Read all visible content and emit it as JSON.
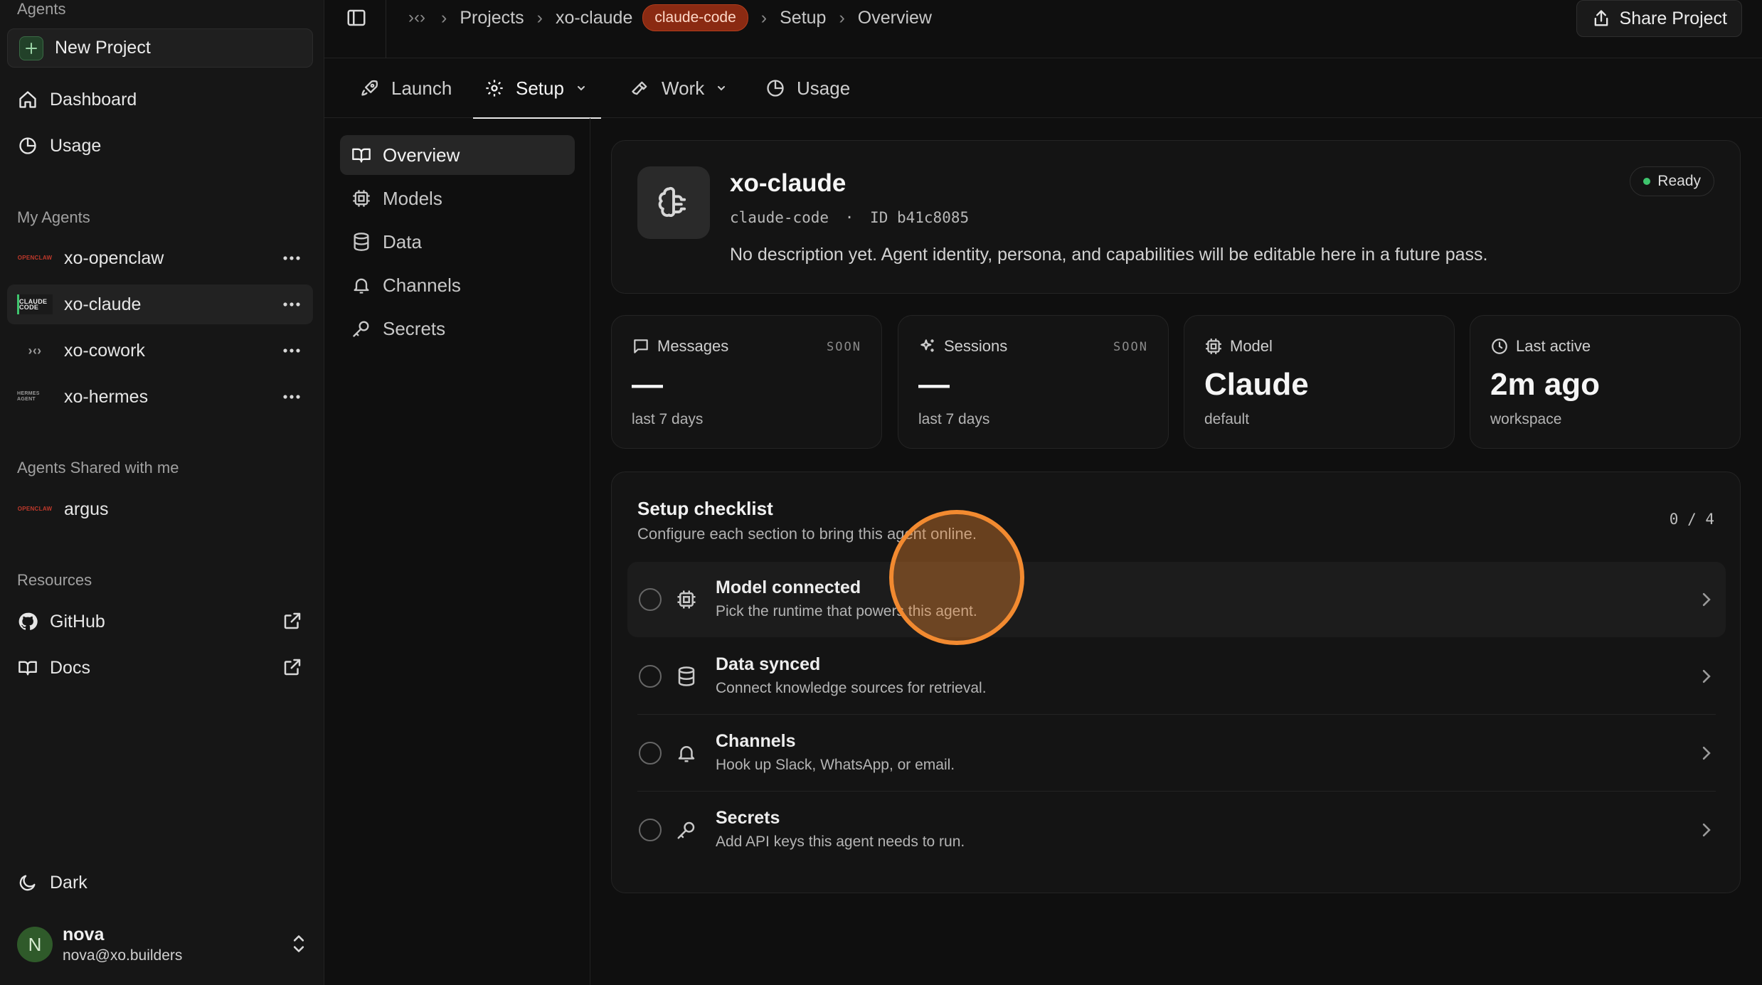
{
  "sidebar": {
    "agents_label": "Agents",
    "new_project": "New Project",
    "nav": [
      {
        "label": "Dashboard",
        "icon": "home-icon"
      },
      {
        "label": "Usage",
        "icon": "pie-chart-icon"
      }
    ],
    "my_agents_label": "My Agents",
    "my_agents": [
      {
        "name": "xo-openclaw",
        "logo": "OPENCLAW"
      },
      {
        "name": "xo-claude",
        "logo": "CLAUDE CODE",
        "active": true
      },
      {
        "name": "xo-cowork",
        "logo": "›‹›"
      },
      {
        "name": "xo-hermes",
        "logo": "HERMES AGENT"
      }
    ],
    "shared_label": "Agents Shared with me",
    "shared": [
      {
        "name": "argus",
        "logo": "OPENCLAW"
      }
    ],
    "resources_label": "Resources",
    "resources": [
      {
        "label": "GitHub"
      },
      {
        "label": "Docs"
      }
    ],
    "theme_label": "Dark",
    "user": {
      "initial": "N",
      "name": "nova",
      "email": "nova@xo.builders"
    }
  },
  "topbar": {
    "logo": "›‹›",
    "breadcrumb": [
      "Projects",
      "xo-claude",
      "Setup",
      "Overview"
    ],
    "pill": "claude-code",
    "share_label": "Share Project"
  },
  "tabs": [
    {
      "label": "Launch"
    },
    {
      "label": "Setup",
      "active": true
    },
    {
      "label": "Work"
    },
    {
      "label": "Usage"
    }
  ],
  "subnav": [
    {
      "label": "Overview",
      "active": true
    },
    {
      "label": "Models"
    },
    {
      "label": "Data"
    },
    {
      "label": "Channels"
    },
    {
      "label": "Secrets"
    }
  ],
  "agent": {
    "title": "xo-claude",
    "type": "claude-code",
    "id_label": "ID b41c8085",
    "separator": "·",
    "description": "No description yet. Agent identity, persona, and capabilities will be editable here in a future pass.",
    "status": "Ready",
    "status_color": "#3ec46d"
  },
  "stats": [
    {
      "label": "Messages",
      "badge": "SOON",
      "value": "—",
      "sub": "last 7 days"
    },
    {
      "label": "Sessions",
      "badge": "SOON",
      "value": "—",
      "sub": "last 7 days"
    },
    {
      "label": "Model",
      "badge": "",
      "value": "Claude",
      "sub": "default"
    },
    {
      "label": "Last active",
      "badge": "",
      "value": "2m ago",
      "sub": "workspace"
    }
  ],
  "checklist": {
    "title": "Setup checklist",
    "subtitle": "Configure each section to bring this agent online.",
    "count": "0 / 4",
    "items": [
      {
        "title": "Model connected",
        "desc": "Pick the runtime that powers this agent."
      },
      {
        "title": "Data synced",
        "desc": "Connect knowledge sources for retrieval."
      },
      {
        "title": "Channels",
        "desc": "Hook up Slack, WhatsApp, or email."
      },
      {
        "title": "Secrets",
        "desc": "Add API keys this agent needs to run."
      }
    ]
  },
  "colors": {
    "accent_pill": "#8a2a12",
    "cursor_ring": "#f28a30"
  }
}
